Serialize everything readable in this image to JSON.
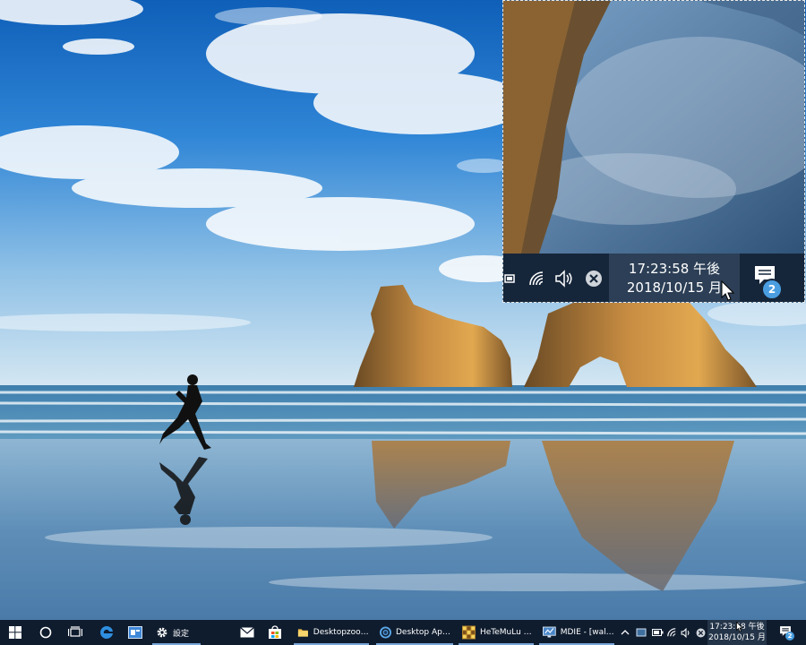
{
  "zoom_view": {
    "clock_time": "17:23:58 午後",
    "clock_date": "2018/10/15 月",
    "notification_count": "2"
  },
  "taskbar": {
    "settings_label": "設定",
    "apps": [
      {
        "label": "Desktopzoom...",
        "icon": "folder-icon"
      },
      {
        "label": "Desktop Appli...",
        "icon": "browser-icon"
      },
      {
        "label": "HeTeMuLu Cr...",
        "icon": "app-grid-icon"
      },
      {
        "label": "MDIE - [wallp...",
        "icon": "monitor-icon"
      }
    ],
    "clock_time": "17:23:58 午後",
    "clock_date": "2018/10/15 月",
    "notification_count": "2"
  },
  "colors": {
    "taskbar_bg": "#0f1c2e",
    "clock_highlight": "#243549",
    "accent": "#4a9ee0"
  }
}
